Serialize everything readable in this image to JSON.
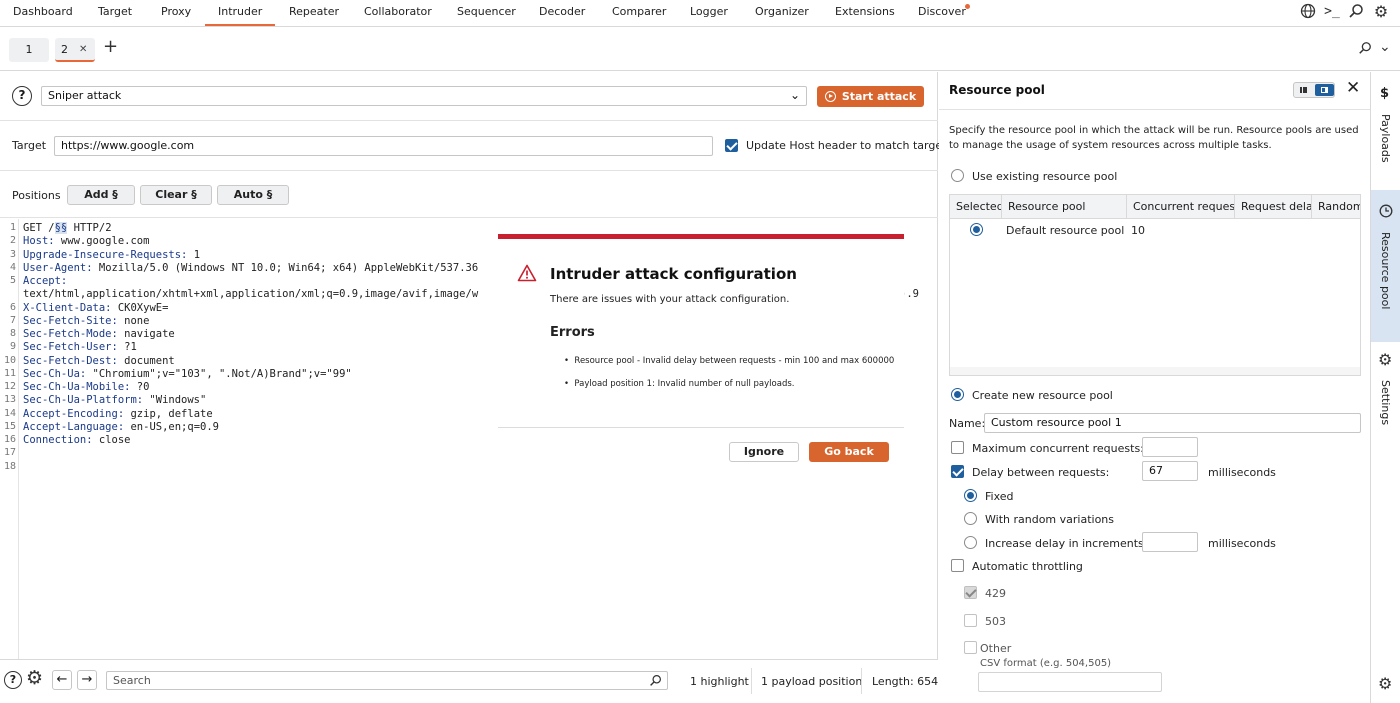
{
  "topnav": {
    "tabs": [
      "Dashboard",
      "Target",
      "Proxy",
      "Intruder",
      "Repeater",
      "Collaborator",
      "Sequencer",
      "Decoder",
      "Comparer",
      "Logger",
      "Organizer",
      "Extensions",
      "Discover"
    ],
    "active": "Intruder"
  },
  "subtabs": {
    "tab1": "1",
    "tab2": "2",
    "close": "✕",
    "add": "+"
  },
  "attack": {
    "type": "Sniper attack",
    "start_label": "Start attack"
  },
  "target": {
    "label": "Target",
    "value": "https://www.google.com",
    "update_host_label": "Update Host header to match target",
    "update_host_checked": true
  },
  "positions": {
    "label": "Positions",
    "add": "Add §",
    "clear": "Clear §",
    "auto": "Auto §"
  },
  "request": {
    "lines": [
      {
        "n": "1",
        "text": "GET /§§ HTTP/2"
      },
      {
        "n": "2",
        "key": "Host:",
        "val": " www.google.com"
      },
      {
        "n": "3",
        "key": "Upgrade-Insecure-Requests:",
        "val": " 1"
      },
      {
        "n": "4",
        "key": "User-Agent:",
        "val": " Mozilla/5.0 (Windows NT 10.0; Win64; x64) AppleWebKit/537.36"
      },
      {
        "n": "5",
        "key": "Accept:",
        "val": ""
      },
      {
        "n": "",
        "text": "text/html,application/xhtml+xml,application/xml;q=0.9,image/avif,image/w"
      },
      {
        "n": "6",
        "key": "X-Client-Data:",
        "val": " CK0XywE="
      },
      {
        "n": "7",
        "key": "Sec-Fetch-Site:",
        "val": " none"
      },
      {
        "n": "8",
        "key": "Sec-Fetch-Mode:",
        "val": " navigate"
      },
      {
        "n": "9",
        "key": "Sec-Fetch-User:",
        "val": " ?1"
      },
      {
        "n": "10",
        "key": "Sec-Fetch-Dest:",
        "val": " document"
      },
      {
        "n": "11",
        "key": "Sec-Ch-Ua:",
        "val": " \"Chromium\";v=\"103\", \".Not/A)Brand\";v=\"99\""
      },
      {
        "n": "12",
        "key": "Sec-Ch-Ua-Mobile:",
        "val": " ?0"
      },
      {
        "n": "13",
        "key": "Sec-Ch-Ua-Platform:",
        "val": " \"Windows\""
      },
      {
        "n": "14",
        "key": "Accept-Encoding:",
        "val": " gzip, deflate"
      },
      {
        "n": "15",
        "key": "Accept-Language:",
        "val": " en-US,en;q=0.9"
      },
      {
        "n": "16",
        "key": "Connection:",
        "val": " close"
      },
      {
        "n": "17",
        "text": ""
      },
      {
        "n": "18",
        "text": ""
      }
    ],
    "line1": {
      "method": "GET /",
      "marker": "§§",
      "rest": " HTTP/2"
    },
    "overflow_fragment": ").9"
  },
  "dialog": {
    "title": "Intruder attack configuration",
    "subtitle": "There are issues with your attack configuration.",
    "errors_heading": "Errors",
    "errors": [
      "Resource pool - Invalid delay between requests - min 100 and max 600000",
      "Payload position 1:  Invalid number of null payloads."
    ],
    "ignore": "Ignore",
    "go_back": "Go back",
    "accent": "#c8202f"
  },
  "bottom": {
    "search_placeholder": "Search",
    "highlights": "1 highlight",
    "payload_positions": "1 payload position",
    "length": "Length: 654"
  },
  "resource_pool": {
    "title": "Resource pool",
    "description": "Specify the resource pool in which the attack will be run. Resource pools are used to manage the usage of system resources across multiple tasks.",
    "use_existing": "Use existing resource pool",
    "table_headers": [
      "Selected",
      "Resource pool",
      "Concurrent requests",
      "Request delay",
      "Random d"
    ],
    "rows": [
      {
        "name": "Default resource pool",
        "concurrent": "10"
      }
    ],
    "create_new": "Create new resource pool",
    "name_label": "Name:",
    "name_value": "Custom resource pool 1",
    "max_concurrent": "Maximum concurrent requests:",
    "delay_label": "Delay between requests:",
    "delay_value": "67",
    "ms": "milliseconds",
    "fixed": "Fixed",
    "random": "With random variations",
    "increase": "Increase delay in increments of",
    "ms2": "milliseconds",
    "auto_throttle": "Automatic throttling",
    "c429": "429",
    "c503": "503",
    "other": "Other",
    "csv": "CSV format (e.g. 504,505)"
  },
  "rail": {
    "payloads": "Payloads",
    "resource_pool": "Resource pool",
    "settings": "Settings"
  },
  "colors": {
    "accent": "#e8683a",
    "button": "#d9652e",
    "blue": "#1f5f9e",
    "rail_active": "#d8e4f2"
  }
}
